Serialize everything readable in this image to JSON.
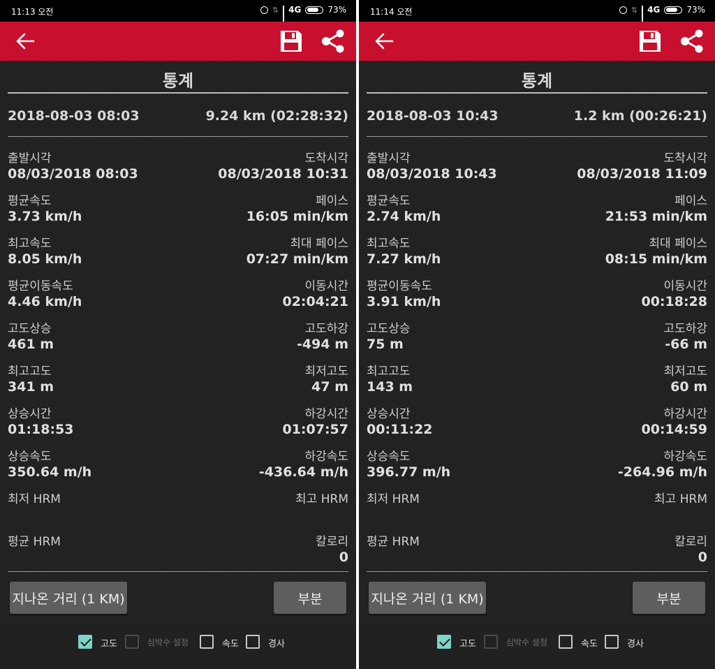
{
  "screens": [
    {
      "status": {
        "time": "11:13 오전",
        "network": "4G",
        "battery": "73%"
      },
      "title": "통계",
      "summary": {
        "start": "2018-08-03 08:03",
        "distance": "9.24 km (02:28:32)"
      },
      "stats": [
        {
          "l_label": "출발시각",
          "l_value": "08/03/2018 08:03",
          "r_label": "도착시각",
          "r_value": "08/03/2018 10:31"
        },
        {
          "l_label": "평균속도",
          "l_value": "3.73 km/h",
          "r_label": "페이스",
          "r_value": "16:05 min/km"
        },
        {
          "l_label": "최고속도",
          "l_value": "8.05 km/h",
          "r_label": "최대 페이스",
          "r_value": "07:27 min/km"
        },
        {
          "l_label": "평균이동속도",
          "l_value": "4.46 km/h",
          "r_label": "이동시간",
          "r_value": "02:04:21"
        },
        {
          "l_label": "고도상승",
          "l_value": "461 m",
          "r_label": "고도하강",
          "r_value": "-494 m"
        },
        {
          "l_label": "최고고도",
          "l_value": "341 m",
          "r_label": "최저고도",
          "r_value": "47 m"
        },
        {
          "l_label": "상승시간",
          "l_value": "01:18:53",
          "r_label": "하강시간",
          "r_value": "01:07:57"
        },
        {
          "l_label": "상승속도",
          "l_value": "350.64 m/h",
          "r_label": "하강속도",
          "r_value": "-436.64 m/h"
        },
        {
          "l_label": "최저 HRM",
          "l_value": "",
          "r_label": "최고 HRM",
          "r_value": ""
        },
        {
          "l_label": "평균 HRM",
          "l_value": "",
          "r_label": "칼로리",
          "r_value": "0"
        }
      ],
      "buttons": {
        "distance": "지나온 거리 (1  KM)",
        "part": "부분"
      },
      "checkboxes": [
        {
          "label": "고도",
          "checked": true
        },
        {
          "label": "심박수 설정",
          "checked": false,
          "disabled": true
        },
        {
          "label": "속도",
          "checked": false
        },
        {
          "label": "경사",
          "checked": false
        }
      ]
    },
    {
      "status": {
        "time": "11:14 오전",
        "network": "4G",
        "battery": "73%"
      },
      "title": "통계",
      "summary": {
        "start": "2018-08-03 10:43",
        "distance": "1.2 km (00:26:21)"
      },
      "stats": [
        {
          "l_label": "출발시각",
          "l_value": "08/03/2018 10:43",
          "r_label": "도착시각",
          "r_value": "08/03/2018 11:09"
        },
        {
          "l_label": "평균속도",
          "l_value": "2.74 km/h",
          "r_label": "페이스",
          "r_value": "21:53 min/km"
        },
        {
          "l_label": "최고속도",
          "l_value": "7.27 km/h",
          "r_label": "최대 페이스",
          "r_value": "08:15 min/km"
        },
        {
          "l_label": "평균이동속도",
          "l_value": "3.91 km/h",
          "r_label": "이동시간",
          "r_value": "00:18:28"
        },
        {
          "l_label": "고도상승",
          "l_value": "75 m",
          "r_label": "고도하강",
          "r_value": "-66 m"
        },
        {
          "l_label": "최고고도",
          "l_value": "143 m",
          "r_label": "최저고도",
          "r_value": "60 m"
        },
        {
          "l_label": "상승시간",
          "l_value": "00:11:22",
          "r_label": "하강시간",
          "r_value": "00:14:59"
        },
        {
          "l_label": "상승속도",
          "l_value": "396.77 m/h",
          "r_label": "하강속도",
          "r_value": "-264.96 m/h"
        },
        {
          "l_label": "최저 HRM",
          "l_value": "",
          "r_label": "최고 HRM",
          "r_value": ""
        },
        {
          "l_label": "평균 HRM",
          "l_value": "",
          "r_label": "칼로리",
          "r_value": "0"
        }
      ],
      "buttons": {
        "distance": "지나온 거리 (1  KM)",
        "part": "부분"
      },
      "checkboxes": [
        {
          "label": "고도",
          "checked": true
        },
        {
          "label": "심박수 설정",
          "checked": false,
          "disabled": true
        },
        {
          "label": "속도",
          "checked": false
        },
        {
          "label": "경사",
          "checked": false
        }
      ]
    }
  ],
  "colors": {
    "accent": "#c8102e",
    "check": "#7fd4c9",
    "background": "#202020"
  }
}
